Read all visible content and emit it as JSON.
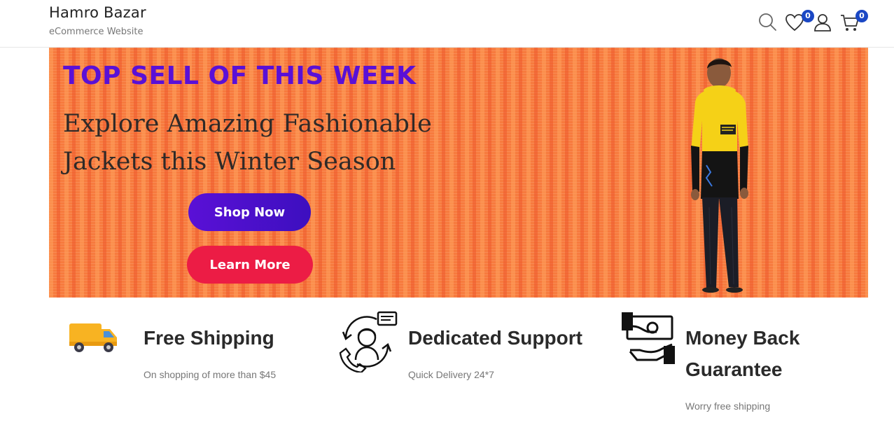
{
  "header": {
    "brand_title": "Hamro Bazar",
    "brand_subtitle": "eCommerce Website",
    "icons": [
      "search-icon",
      "heart-icon",
      "user-icon",
      "cart-icon"
    ],
    "wishlist_count": "0",
    "cart_count": "0"
  },
  "banner": {
    "kicker": "TOP SELL OF THIS WEEK",
    "headline": "Explore Amazing Fashionable Jackets this Winter Season",
    "shop_now_label": "Shop Now",
    "learn_more_label": "Learn More",
    "image": "model-in-yellow-jacket"
  },
  "features": [
    {
      "icon": "truck-icon",
      "title": "Free Shipping",
      "description": "On shopping of more than $45"
    },
    {
      "icon": "support-agent-icon",
      "title": "Dedicated Support",
      "description": "Quick Delivery 24*7"
    },
    {
      "icon": "money-back-icon",
      "title": "Money Back Guarantee",
      "description": "Worry free shipping"
    }
  ],
  "colors": {
    "accent_purple": "#5a10d6",
    "accent_red": "#ec1c45",
    "banner_orange": "#f77b3e",
    "badge_blue": "#1a47c4"
  }
}
